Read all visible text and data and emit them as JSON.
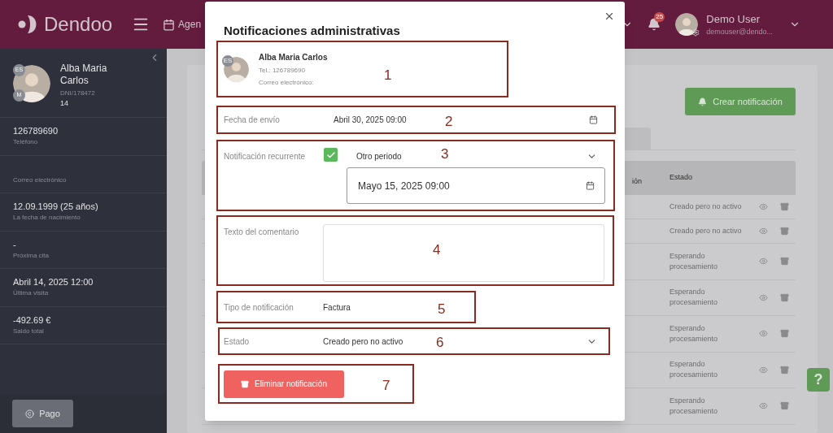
{
  "header": {
    "brand": "Dendoo",
    "nav_item": "Agen",
    "notifications_badge": "25",
    "user": {
      "name": "Demo User",
      "email": "demouser@dendo..."
    }
  },
  "sidebar": {
    "patient": {
      "name": "Alba Maria Carlos",
      "id": "DNI/178472",
      "number": "14",
      "badges": [
        "ES",
        "M"
      ]
    },
    "items": [
      {
        "value": "126789690",
        "label": "Teléfono"
      },
      {
        "label": "Correo electrónico"
      },
      {
        "value": "12.09.1999 (25 años)",
        "label": "La fecha de nacimiento"
      },
      {
        "value": "-",
        "label": "Próxima cita"
      },
      {
        "value": "Abril 14, 2025 12:00",
        "label": "Última visita"
      },
      {
        "value": "-492.69 €",
        "label": "Saldo total"
      }
    ],
    "pay_button": "Pago"
  },
  "page": {
    "create_button": "Crear notificación",
    "table": {
      "columns": [
        "ión",
        "Estado"
      ],
      "rows": [
        {
          "status": "Creado pero no activo"
        },
        {
          "status": "Creado pero no activo"
        },
        {
          "status": "Esperando procesamiento"
        },
        {
          "status": "Esperando procesamiento"
        },
        {
          "status": "Esperando procesamiento"
        },
        {
          "status": "Esperando procesamiento"
        },
        {
          "status": "Esperando procesamiento"
        }
      ]
    },
    "help_button": "?"
  },
  "dialog": {
    "title": "Notificaciones administrativas",
    "patient": {
      "name": "Alba Maria Carlos",
      "badge": "ES",
      "phone": "Tel.: 126789690",
      "email_label": "Correo electrónico:",
      "callout": "1"
    },
    "send_date": {
      "label": "Fecha de envío",
      "value": "Abril 30, 2025 09:00",
      "callout": "2"
    },
    "recurrent": {
      "label": "Notificación recurrente",
      "checked": true,
      "period": "Otro periodo",
      "until": "Mayo 15, 2025 09:00",
      "callout": "3"
    },
    "comment": {
      "label": "Texto del comentario",
      "callout": "4"
    },
    "type": {
      "label": "Tipo de notificación",
      "value": "Factura",
      "callout": "5"
    },
    "status": {
      "label": "Estado",
      "value": "Creado pero no activo",
      "callout": "6"
    },
    "delete_button": {
      "label": "Eliminar notificación",
      "callout": "7"
    }
  }
}
